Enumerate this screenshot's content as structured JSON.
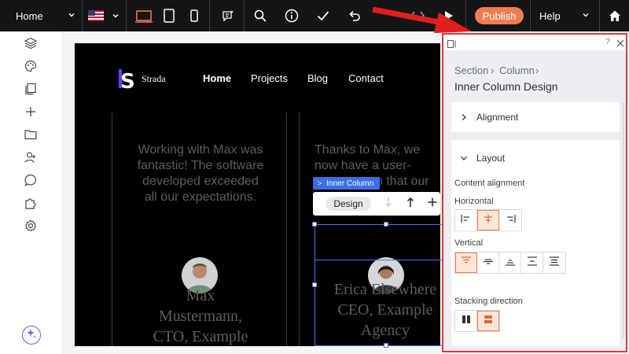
{
  "toolbar": {
    "page_label": "Home",
    "publish_label": "Publish",
    "help_label": "Help",
    "icons": [
      "us-flag-icon",
      "desktop-icon",
      "tablet-icon",
      "mobile-icon",
      "ai-chat-icon",
      "search-icon",
      "info-icon",
      "check-icon",
      "undo-icon",
      "code-icon",
      "play-icon",
      "home-icon"
    ]
  },
  "rail": {
    "icons": [
      "layers-icon",
      "palette-icon",
      "pages-icon",
      "add-icon",
      "folder-icon",
      "people-icon",
      "chat-icon",
      "puzzle-icon",
      "gear-icon",
      "ai-sparkle-icon"
    ]
  },
  "site": {
    "logo": "S",
    "brand": "Strada",
    "nav": [
      "Home",
      "Projects",
      "Blog",
      "Contact"
    ],
    "testimonials": [
      {
        "quote_lines": [
          "Working with Max was",
          "fantastic! The software",
          "developed exceeded",
          "all our expectations."
        ],
        "name_lines": [
          "Max",
          "Mustermann,",
          "CTO, Example"
        ]
      },
      {
        "quote_lines": [
          "Thanks to Max, we",
          "now have a user-",
          "o that our"
        ],
        "name_lines": [
          "Erica Elsewhere",
          "CEO, Example",
          "Agency"
        ]
      }
    ]
  },
  "selection": {
    "tag_label": "Inner Column",
    "design_label": "Design"
  },
  "panel": {
    "breadcrumb": [
      "Section",
      "Column"
    ],
    "title": "Inner Column Design",
    "help": "?",
    "alignment_label": "Alignment",
    "layout_label": "Layout",
    "content_alignment_label": "Content alignment",
    "horizontal_label": "Horizontal",
    "vertical_label": "Vertical",
    "stacking_label": "Stacking direction",
    "horizontal_selected": 1,
    "vertical_selected": 0,
    "stacking_selected": 1
  },
  "colors": {
    "toolbar_bg": "#131517",
    "publish": "#f07c52",
    "selection": "#3b6fe8",
    "panel_border": "#d43a3a",
    "selected_option": "#fde6d8"
  }
}
